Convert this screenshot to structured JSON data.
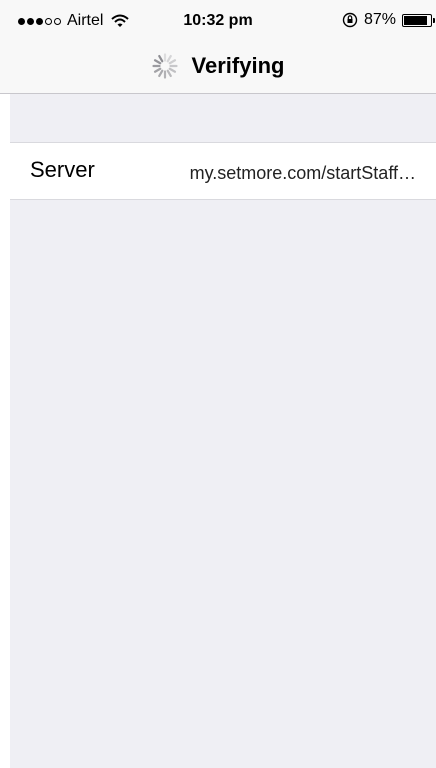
{
  "status_bar": {
    "carrier": "Airtel",
    "signal_dots_filled": 3,
    "signal_dots_total": 5,
    "time": "10:32 pm",
    "battery_percent_label": "87%",
    "battery_level": 0.87,
    "icons": [
      "signal-dots-icon",
      "wifi-icon",
      "rotation-lock-icon",
      "battery-icon"
    ]
  },
  "navbar": {
    "title": "Verifying",
    "spinner_icon": "activity-spinner-icon"
  },
  "settings": {
    "rows": [
      {
        "label": "Server",
        "value": "my.setmore.com/startStaff…"
      }
    ]
  },
  "colors": {
    "background": "#efeff4",
    "bar": "#f8f8f8",
    "separator": "#c8c7cc"
  }
}
